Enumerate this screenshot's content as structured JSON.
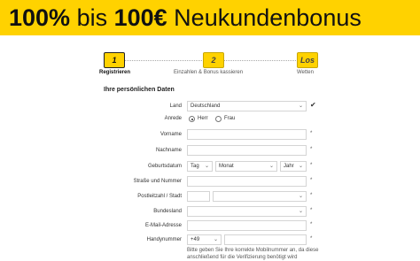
{
  "banner": {
    "part1": "100%",
    "part2": " bis ",
    "part3": "100€",
    "part4": " Neukundenbonus"
  },
  "steps": [
    {
      "number": "1",
      "label": "Registrieren"
    },
    {
      "number": "2",
      "label": "Einzahlen & Bonus kassieren"
    },
    {
      "number": "Los",
      "label": "Wetten"
    }
  ],
  "section_title": "Ihre persönlichen Daten",
  "form": {
    "country": {
      "label": "Land",
      "value": "Deutschland"
    },
    "salutation": {
      "label": "Anrede",
      "options": [
        "Herr",
        "Frau"
      ],
      "selected": "Herr"
    },
    "first_name": {
      "label": "Vorname",
      "value": ""
    },
    "last_name": {
      "label": "Nachname",
      "value": ""
    },
    "birthdate": {
      "label": "Geburtsdatum",
      "day": "Tag",
      "month": "Monat",
      "year": "Jahr"
    },
    "street": {
      "label": "Straße und Nummer",
      "value": ""
    },
    "zip_city": {
      "label": "Postleitzahl / Stadt",
      "zip": "",
      "city": ""
    },
    "state": {
      "label": "Bundesland",
      "value": ""
    },
    "email": {
      "label": "E-Mail-Adresse",
      "value": ""
    },
    "mobile": {
      "label": "Handynummer",
      "prefix": "+49",
      "value": ""
    }
  },
  "hint_line1": "Bitte geben Sie Ihre korrekte Mobilnummer an, da diese",
  "hint_line2": "anschließend für die Verifizierung benötigt wird",
  "required_marker": "*"
}
